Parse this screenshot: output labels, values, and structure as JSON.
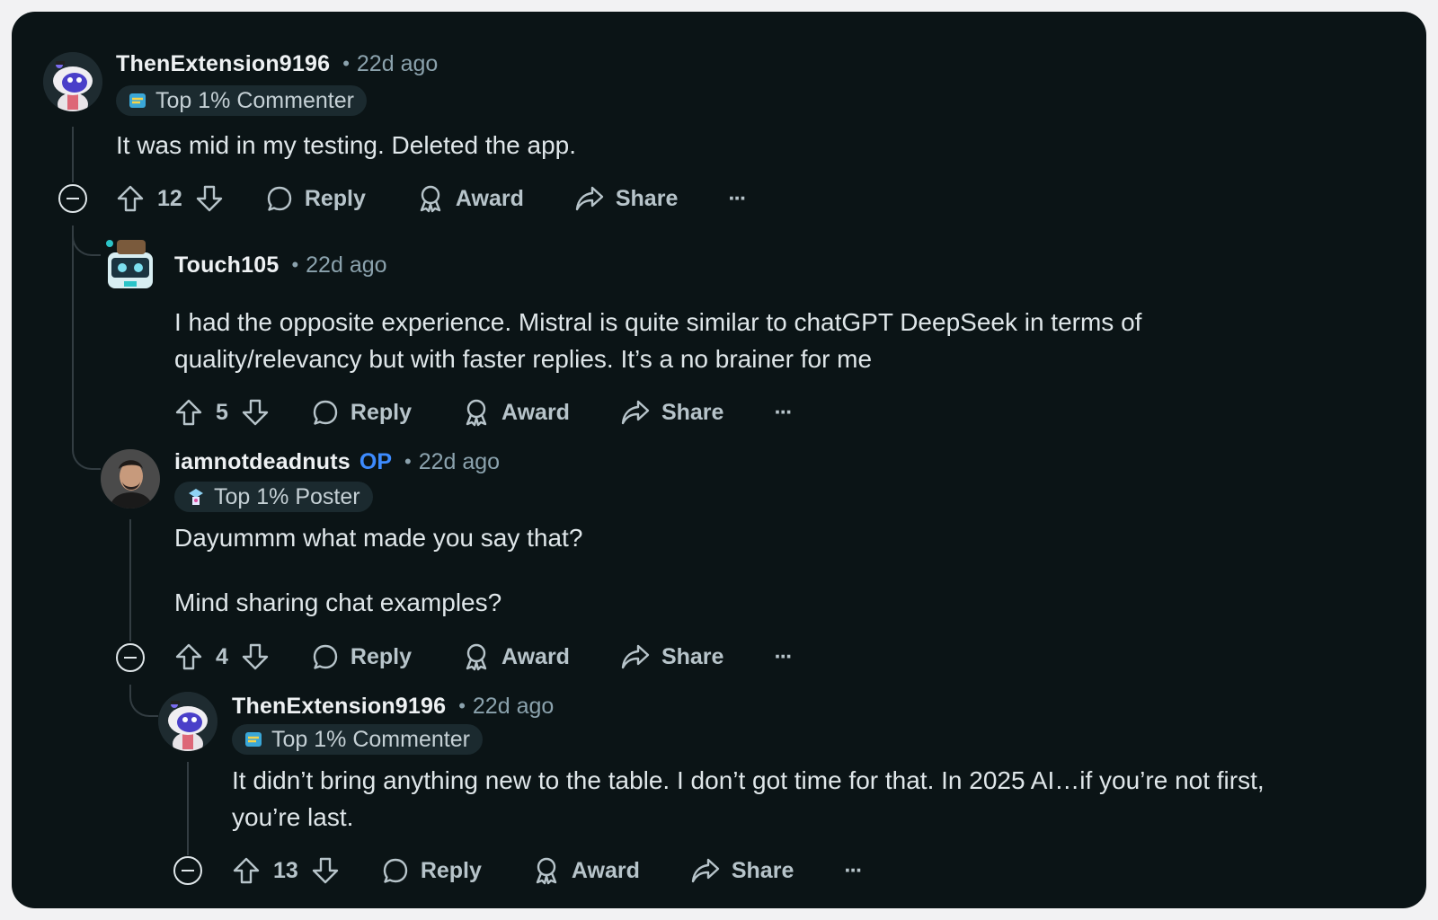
{
  "labels": {
    "reply": "Reply",
    "award": "Award",
    "share": "Share",
    "more": "···"
  },
  "comments": [
    {
      "username": "ThenExtension9196",
      "time": "22d ago",
      "flair": "Top 1% Commenter",
      "lines": [
        "It was mid in my testing. Deleted the app."
      ],
      "votes": "12"
    },
    {
      "username": "Touch105",
      "time": "22d ago",
      "lines": [
        "I had the opposite experience. Mistral is quite similar to chatGPT DeepSeek in terms of",
        "quality/relevancy but with faster replies. It’s a no brainer for me"
      ],
      "votes": "5"
    },
    {
      "username": "iamnotdeadnuts",
      "op_badge": "OP",
      "time": "22d ago",
      "flair": "Top 1% Poster",
      "lines": [
        "Dayummm what made you say that?",
        "Mind sharing chat examples?"
      ],
      "votes": "4"
    },
    {
      "username": "ThenExtension9196",
      "time": "22d ago",
      "flair": "Top 1% Commenter",
      "lines": [
        "It didn’t bring anything new to the table. I don’t got time for that. In 2025 AI…if you’re not first,",
        "you’re last."
      ],
      "votes": "13"
    }
  ],
  "colors": {
    "background": "#0b1416",
    "op": "#3d8bff",
    "text": "#dfe6e9",
    "muted": "#8ba2ad"
  }
}
